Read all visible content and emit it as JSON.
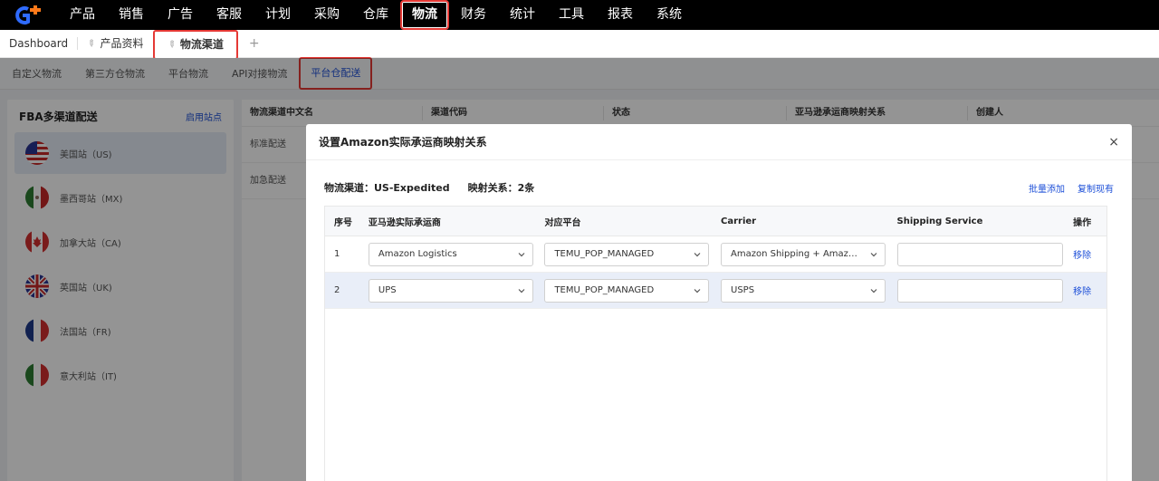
{
  "nav": {
    "items": [
      "产品",
      "销售",
      "广告",
      "客服",
      "计划",
      "采购",
      "仓库",
      "物流",
      "财务",
      "统计",
      "工具",
      "报表",
      "系统"
    ],
    "active_index": 7
  },
  "tabs": {
    "dashboard": "Dashboard",
    "product": "产品资料",
    "channel": "物流渠道",
    "add": "+"
  },
  "subtabs": {
    "items": [
      "自定义物流",
      "第三方仓物流",
      "平台物流",
      "API对接物流",
      "平台仓配送"
    ],
    "active_index": 4
  },
  "left": {
    "title": "FBA多渠道配送",
    "link": "启用站点",
    "sites": [
      "美国站（US)",
      "墨西哥站（MX)",
      "加拿大站（CA)",
      "英国站（UK)",
      "法国站（FR)",
      "意大利站（IT)"
    ]
  },
  "main": {
    "columns": [
      "物流渠道中文名",
      "渠道代码",
      "状态",
      "亚马逊承运商映射关系",
      "创建人"
    ],
    "rows": [
      "标准配送",
      "加急配送"
    ]
  },
  "modal": {
    "title": "设置Amazon实际承运商映射关系",
    "close": "×",
    "channel_label": "物流渠道：US-Expedited",
    "mapping_label": "映射关系：2条",
    "batch_add": "批量添加",
    "copy_existing": "复制现有",
    "columns": {
      "idx": "序号",
      "amazon": "亚马逊实际承运商",
      "platform": "对应平台",
      "carrier": "Carrier",
      "service": "Shipping Service",
      "op": "操作"
    },
    "rows": [
      {
        "idx": "1",
        "amazon": "Amazon Logistics",
        "platform": "TEMU_POP_MANAGED",
        "carrier": "Amazon Shipping + Amazon ...",
        "service": "",
        "op": "移除"
      },
      {
        "idx": "2",
        "amazon": "UPS",
        "platform": "TEMU_POP_MANAGED",
        "carrier": "USPS",
        "service": "",
        "op": "移除"
      }
    ]
  }
}
